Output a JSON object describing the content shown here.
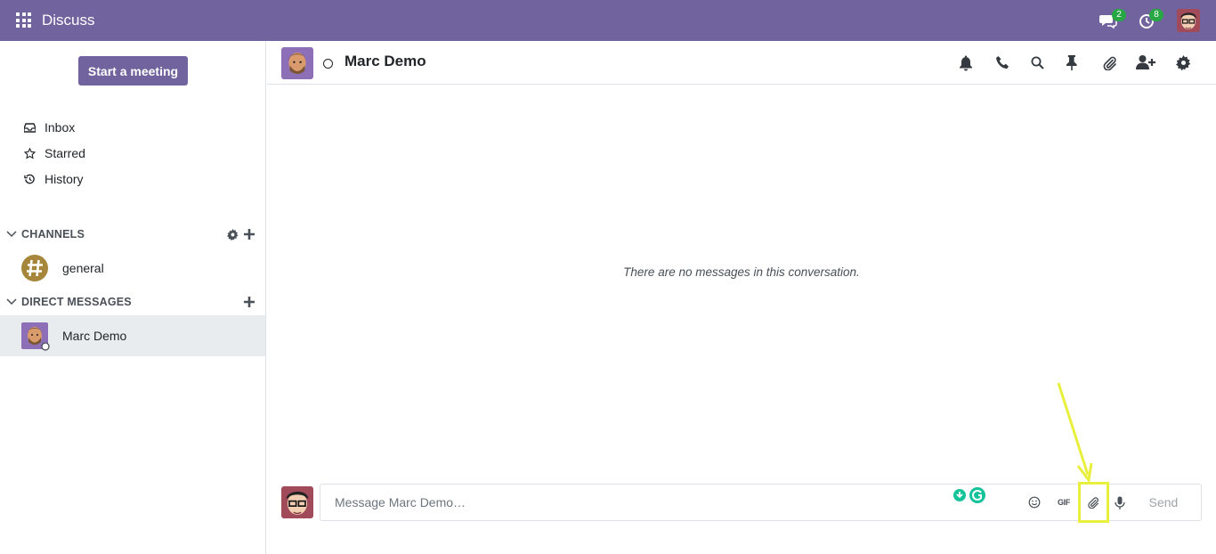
{
  "app": {
    "title": "Discuss",
    "icons": [
      "apps-grid-icon",
      "chat-icon",
      "activity-clock-icon"
    ],
    "messages_badge": "2",
    "activity_badge": "8",
    "accent_color": "#71639e",
    "badge_color": "#28a745"
  },
  "sidebar": {
    "start_meeting_label": "Start a meeting",
    "mailboxes": [
      {
        "label": "Inbox",
        "icon": "inbox-icon"
      },
      {
        "label": "Starred",
        "icon": "star-icon"
      },
      {
        "label": "History",
        "icon": "history-icon"
      }
    ],
    "channels_header": "CHANNELS",
    "channels": [
      {
        "name": "general",
        "icon": "hashtag-icon"
      }
    ],
    "dm_header": "DIRECT MESSAGES",
    "direct_messages": [
      {
        "name": "Marc Demo",
        "active": true,
        "status": "offline"
      }
    ]
  },
  "thread": {
    "name": "Marc Demo",
    "status": "offline",
    "header_actions": [
      "bell-icon",
      "phone-icon",
      "search-icon",
      "pin-icon",
      "paperclip-icon",
      "add-user-icon",
      "gear-icon"
    ],
    "empty_text": "There are no messages in this conversation."
  },
  "composer": {
    "placeholder": "Message Marc Demo…",
    "gif_label": "GIF",
    "send_label": "Send",
    "actions": [
      "emoji-icon",
      "gif-icon",
      "paperclip-icon",
      "microphone-icon"
    ]
  },
  "annotation": {
    "highlight_color": "#e8ef3c",
    "target": "attach-files-button"
  }
}
